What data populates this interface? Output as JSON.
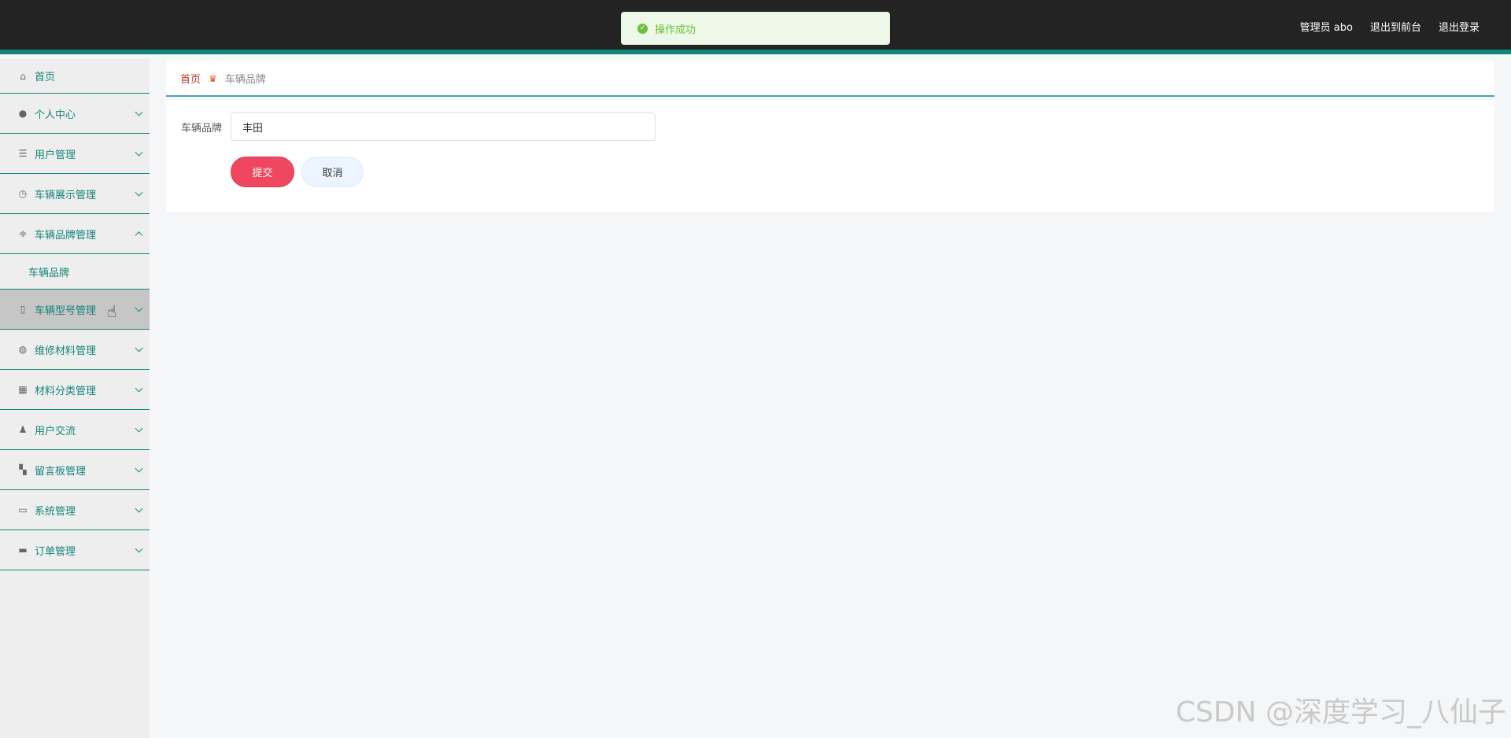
{
  "header": {
    "admin_label": "管理员 abo",
    "front_link": "退出到前台",
    "logout_link": "退出登录",
    "accent_color": "#12857a"
  },
  "toast": {
    "message": "操作成功",
    "icon": "check-circle-icon",
    "color": "#67c23a"
  },
  "sidebar": {
    "items": [
      {
        "label": "首页",
        "icon": "home-icon"
      },
      {
        "label": "个人中心",
        "icon": "user-icon"
      },
      {
        "label": "用户管理",
        "icon": "list-icon"
      },
      {
        "label": "车辆展示管理",
        "icon": "clock-icon"
      },
      {
        "label": "车辆品牌管理",
        "icon": "sliders-icon",
        "expanded": true,
        "sub": "车辆品牌"
      },
      {
        "label": "车辆型号管理",
        "icon": "mic-icon",
        "hovered": true
      },
      {
        "label": "维修材料管理",
        "icon": "globe-icon"
      },
      {
        "label": "材料分类管理",
        "icon": "grid-icon"
      },
      {
        "label": "用户交流",
        "icon": "person-icon"
      },
      {
        "label": "留言板管理",
        "icon": "apps-icon"
      },
      {
        "label": "系统管理",
        "icon": "message-icon"
      },
      {
        "label": "订单管理",
        "icon": "chat-icon"
      }
    ]
  },
  "breadcrumb": {
    "home": "首页",
    "current": "车辆品牌"
  },
  "form": {
    "label": "车辆品牌",
    "value": "丰田",
    "submit": "提交",
    "cancel": "取消",
    "submit_color": "#ef4760"
  },
  "watermark": "CSDN @深度学习_八仙子"
}
